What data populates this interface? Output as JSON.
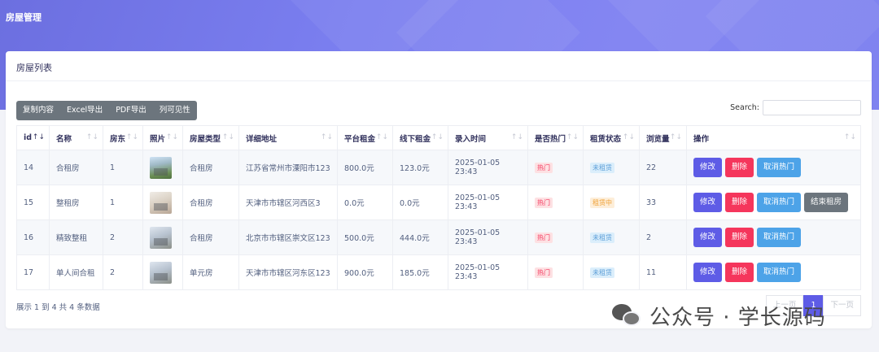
{
  "header": {
    "title": "房屋管理"
  },
  "card": {
    "title": "房屋列表"
  },
  "toolbar": {
    "buttons": [
      "复制内容",
      "Excel导出",
      "PDF导出",
      "列可见性"
    ],
    "search_label": "Search:",
    "search_value": ""
  },
  "table": {
    "columns": [
      "id",
      "名称",
      "房东",
      "照片",
      "房屋类型",
      "详细地址",
      "平台租金",
      "线下租金",
      "录入时间",
      "是否热门",
      "租赁状态",
      "浏览量",
      "操作"
    ],
    "rows": [
      {
        "id": "14",
        "name": "合租房",
        "landlord": "1",
        "photo": "house-exterior",
        "type": "合租房",
        "address": "江苏省常州市溧阳市123",
        "platform_rent": "800.0元",
        "offline_rent": "123.0元",
        "time": "2025-01-05 23:43",
        "hot": "热门",
        "status": "未租赁",
        "views": "22",
        "actions": [
          "修改",
          "删除",
          "取消热门"
        ]
      },
      {
        "id": "15",
        "name": "整租房",
        "landlord": "1",
        "photo": "room-interior",
        "type": "合租房",
        "address": "天津市市辖区河西区3",
        "platform_rent": "0.0元",
        "offline_rent": "0.0元",
        "time": "2025-01-05 23:43",
        "hot": "热门",
        "status": "租赁中",
        "views": "33",
        "actions": [
          "修改",
          "删除",
          "取消热门",
          "结束租房"
        ]
      },
      {
        "id": "16",
        "name": "精致整租",
        "landlord": "2",
        "photo": "room-interior",
        "type": "合租房",
        "address": "北京市市辖区崇文区123",
        "platform_rent": "500.0元",
        "offline_rent": "444.0元",
        "time": "2025-01-05 23:43",
        "hot": "热门",
        "status": "未租赁",
        "views": "2",
        "actions": [
          "修改",
          "删除",
          "取消热门"
        ]
      },
      {
        "id": "17",
        "name": "单人间合租",
        "landlord": "2",
        "photo": "room-interior",
        "type": "单元房",
        "address": "天津市市辖区河东区123",
        "platform_rent": "900.0元",
        "offline_rent": "185.0元",
        "time": "2025-01-05 23:43",
        "hot": "热门",
        "status": "未租赁",
        "views": "11",
        "actions": [
          "修改",
          "删除",
          "取消热门"
        ]
      }
    ]
  },
  "footer": {
    "info": "展示 1 到 4 共 4 条数据",
    "pagination": [
      "上一页",
      "1",
      "下一页"
    ],
    "current_page": "1"
  },
  "watermark": {
    "text": "公众号 · 学长源码"
  },
  "colors": {
    "header_gradient_start": "#6c6fe0",
    "header_gradient_end": "#8486f2",
    "edit": "#5e5ce6",
    "delete": "#f5365c",
    "cancel_hot": "#4da3e8",
    "end_rent": "#6c757d"
  }
}
